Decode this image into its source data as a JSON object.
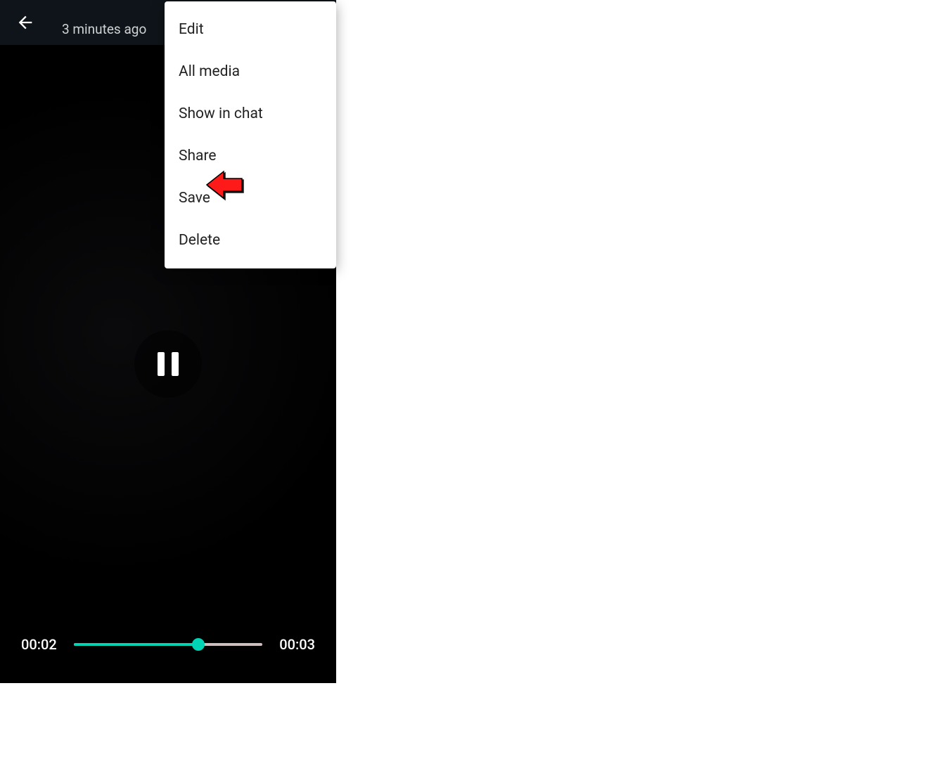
{
  "header": {
    "timestamp": "3 minutes ago"
  },
  "menu": {
    "items": [
      {
        "label": "Edit"
      },
      {
        "label": "All media"
      },
      {
        "label": "Show in chat"
      },
      {
        "label": "Share"
      },
      {
        "label": "Save"
      },
      {
        "label": "Delete"
      }
    ]
  },
  "playback": {
    "current_time": "00:02",
    "total_time": "00:03",
    "progress_percent": 66
  },
  "colors": {
    "accent": "#00d4b5",
    "annotation": "#ff1a1a"
  }
}
